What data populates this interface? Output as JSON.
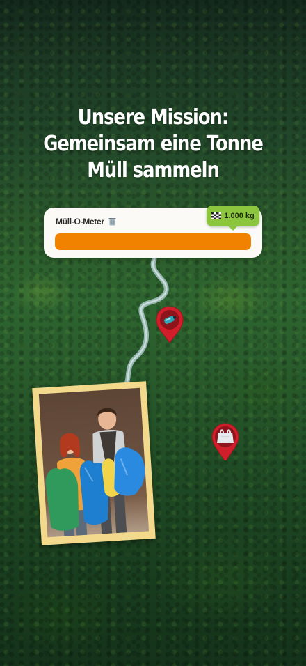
{
  "mission": {
    "title_line1": "Unsere Mission:",
    "title_line2": "Gemeinsam eine Tonne",
    "title_line3": "Müll sammeln"
  },
  "meter": {
    "label": "Müll-O-Meter",
    "icon": "trash-bin-icon",
    "goal_label": "1.000 kg",
    "goal_icon": "checkered-flag-icon",
    "progress_fraction": 1.0
  },
  "map": {
    "pins": [
      {
        "icon": "bottle-icon"
      },
      {
        "icon": "plastic-bag-icon"
      }
    ]
  },
  "photo": {
    "description_icon": "volunteers-photo"
  },
  "colors": {
    "accent_orange": "#f08200",
    "goal_green": "#8cc63f",
    "pin_red": "#d01f2a",
    "photo_frame": "#f2d98b"
  }
}
